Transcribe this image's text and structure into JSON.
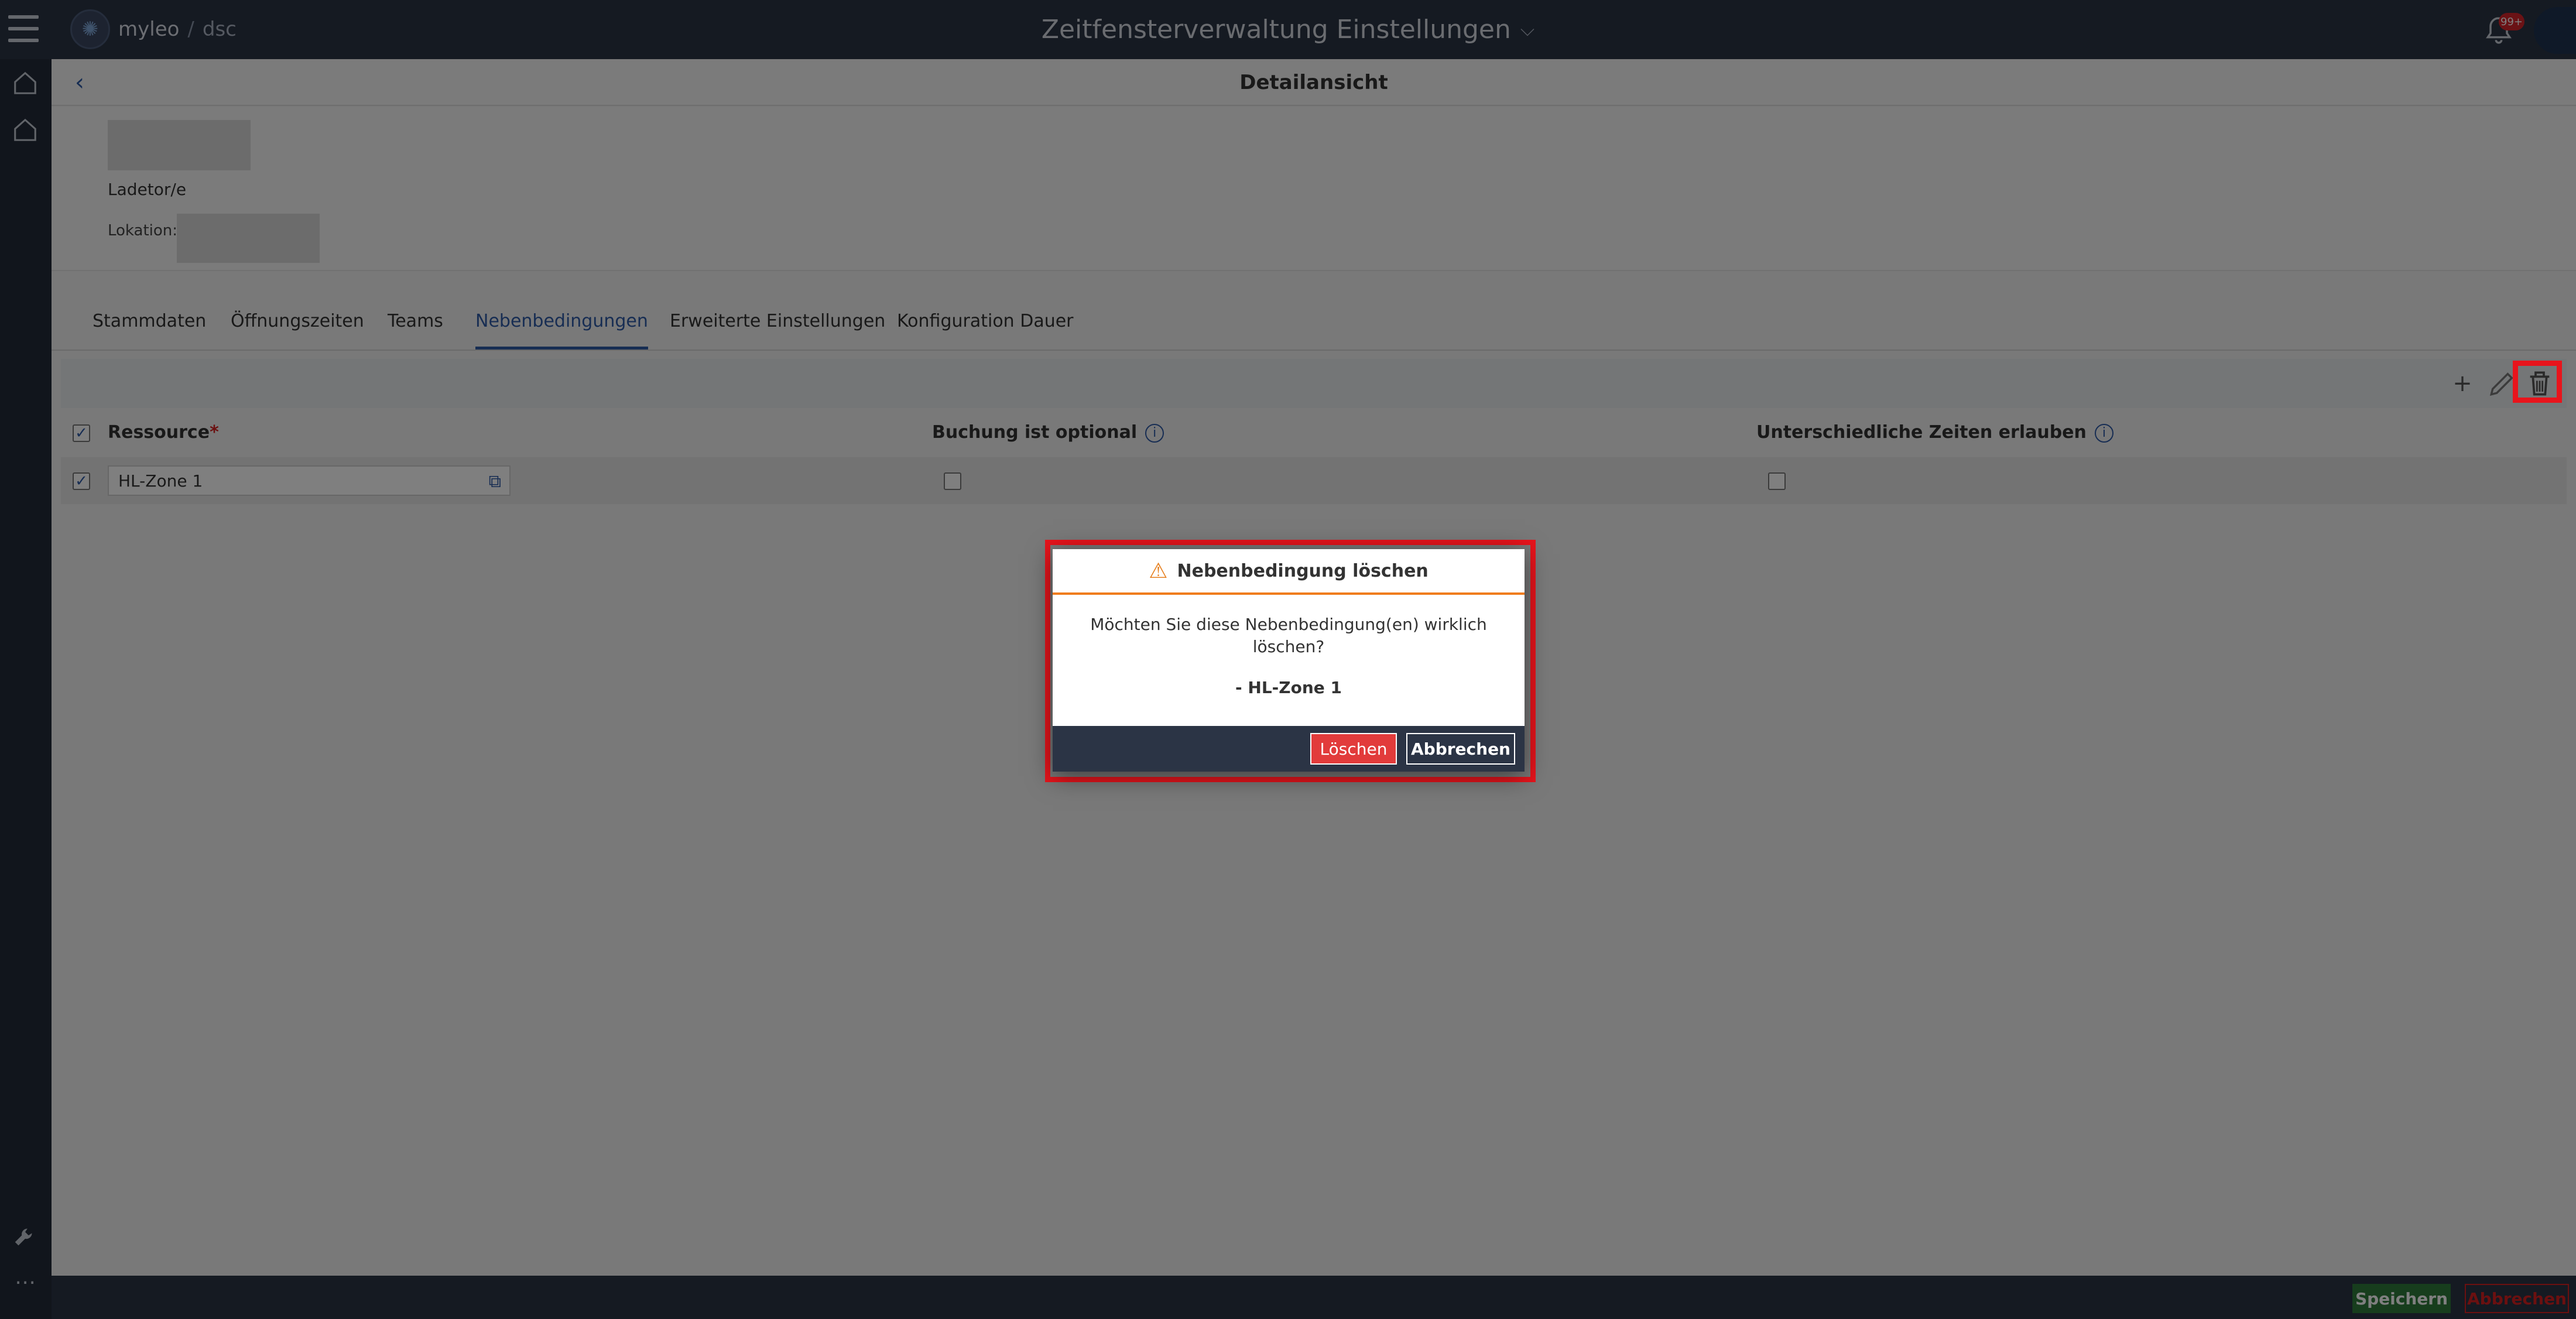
{
  "app": {
    "logo_name": "myleo",
    "logo_sep": "/",
    "logo_product": "dsc",
    "title": "Zeitfensterverwaltung Einstellungen",
    "notification_badge": "99+"
  },
  "header": {
    "title": "Detailansicht"
  },
  "info": {
    "ladetor_label": "Ladetor/e",
    "lokation_label": "Lokation:"
  },
  "tabs": [
    {
      "label": "Stammdaten"
    },
    {
      "label": "Öffnungszeiten"
    },
    {
      "label": "Teams"
    },
    {
      "label": "Nebenbedingungen"
    },
    {
      "label": "Erweiterte Einstellungen"
    },
    {
      "label": "Konfiguration Dauer"
    }
  ],
  "active_tab": "Nebenbedingungen",
  "table": {
    "columns": [
      {
        "label": "Ressource",
        "required": "*"
      },
      {
        "label": "Buchung ist optional"
      },
      {
        "label": "Unterschiedliche Zeiten erlauben"
      }
    ],
    "rows": [
      {
        "ressource": "HL-Zone 1",
        "selected": true,
        "buchung_optional": false,
        "unterschiedliche_zeiten": false
      }
    ]
  },
  "footer": {
    "save_label": "Speichern",
    "cancel_label": "Abbrechen"
  },
  "dialog": {
    "title": "Nebenbedingung löschen",
    "message": "Möchten Sie diese Nebenbedingung(en) wirklich löschen?",
    "item": "- HL-Zone 1",
    "delete_label": "Löschen",
    "cancel_label": "Abbrechen"
  },
  "colors": {
    "topbar": "#2b3445",
    "accent": "#2e5aa7",
    "highlight": "#e8141c",
    "warning": "#f07c1c",
    "danger": "#e23b3b"
  }
}
